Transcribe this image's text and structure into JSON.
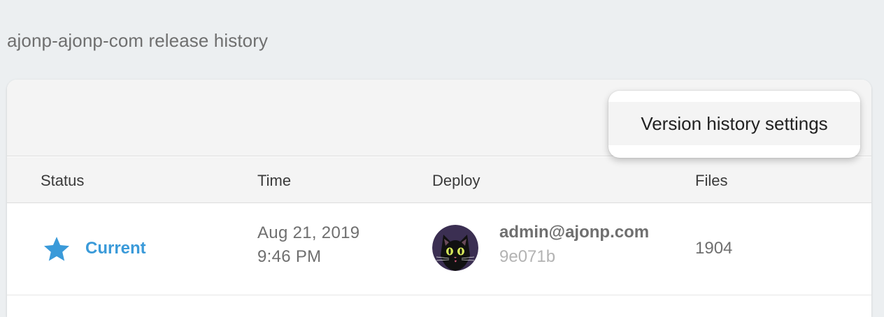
{
  "page": {
    "heading": "ajonp-ajonp-com release history"
  },
  "menu": {
    "items": [
      {
        "label": "Version history settings"
      }
    ]
  },
  "table": {
    "columns": [
      "Status",
      "Time",
      "Deploy",
      "Files"
    ],
    "rows": [
      {
        "status": "Current",
        "status_icon": "star-icon",
        "date": "Aug 21, 2019",
        "time": "9:46 PM",
        "avatar_icon": "black-cat-avatar",
        "user": "admin@ajonp.com",
        "hash": "9e071b",
        "files": "1904"
      }
    ]
  },
  "colors": {
    "accent": "#3a9ad9",
    "background": "#eceff1",
    "avatar_bg": "#3b2f52"
  }
}
